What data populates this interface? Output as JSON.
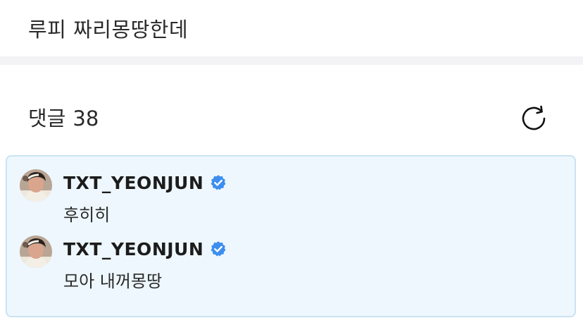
{
  "post": {
    "text": "루피 짜리몽땅한데"
  },
  "comments": {
    "label": "댓글",
    "count": "38",
    "refresh_icon": "refresh-icon",
    "items": [
      {
        "author": "TXT_YEONJUN",
        "verified": true,
        "text": "후히히"
      },
      {
        "author": "TXT_YEONJUN",
        "verified": true,
        "text": "모아 내꺼몽땅"
      }
    ]
  },
  "colors": {
    "highlight_background": "#eef7fd",
    "highlight_border": "#c9e3f2",
    "verified_badge": "#3d8ef0",
    "divider": "#f3f3f5"
  }
}
